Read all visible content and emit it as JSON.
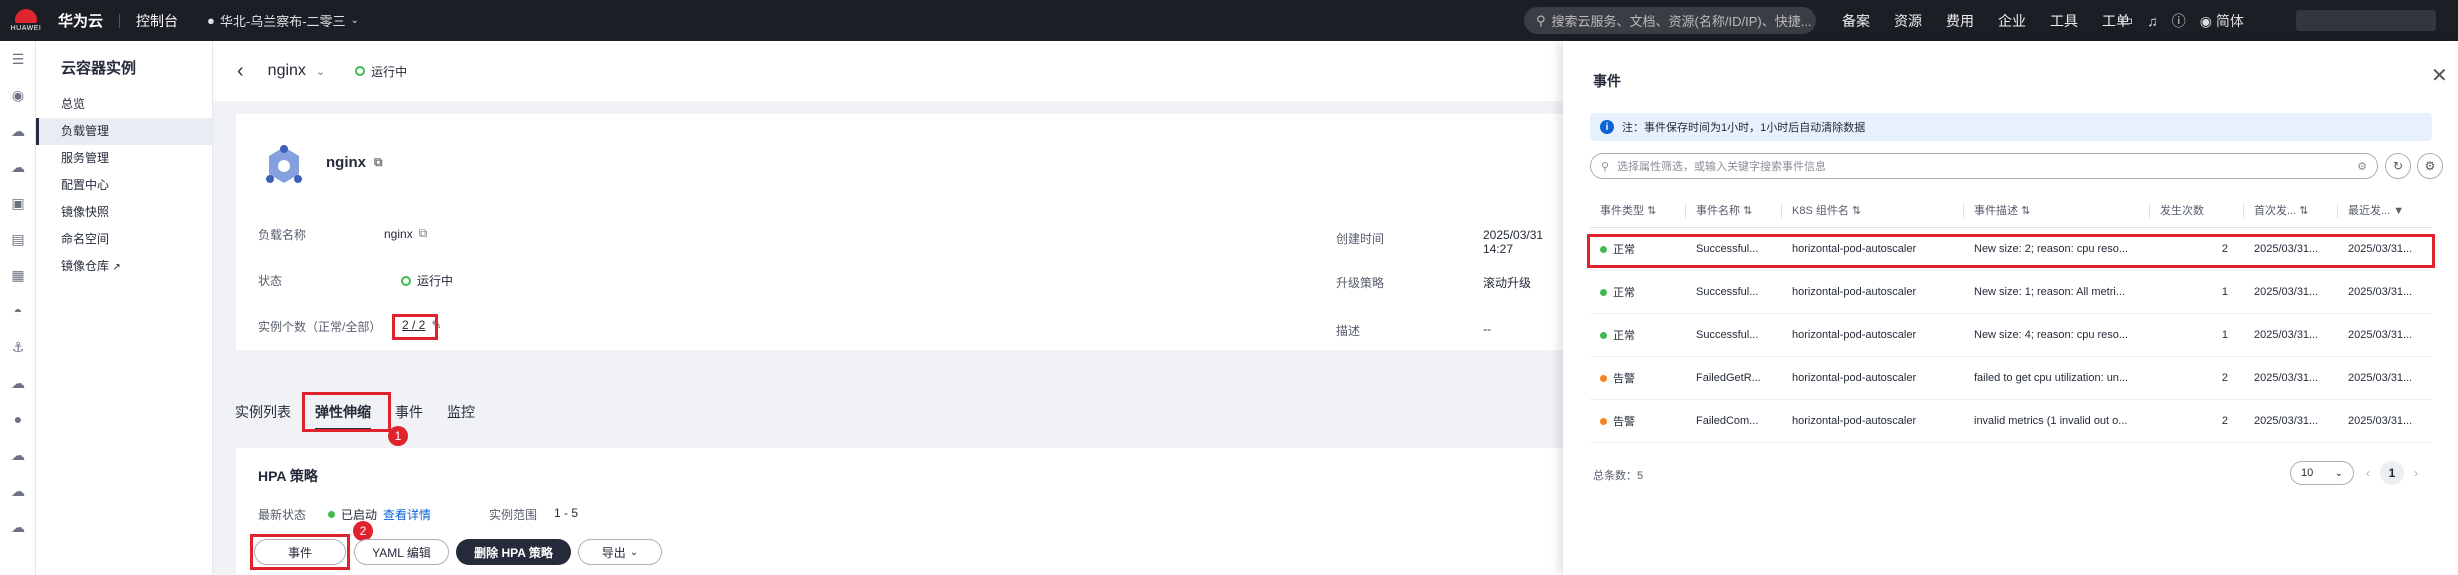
{
  "topbar": {
    "logo_text": "HUAWEI",
    "brand": "华为云",
    "console": "控制台",
    "region": "华北-乌兰察布-二零三",
    "search_placeholder": "搜索云服务、文档、资源(名称/ID/IP)、快捷...",
    "nav": [
      "备案",
      "资源",
      "费用",
      "企业",
      "工具",
      "工单"
    ],
    "lang": "简体"
  },
  "sidemenu": {
    "title": "云容器实例",
    "items": [
      "总览",
      "负载管理",
      "服务管理",
      "配置中心",
      "镜像快照",
      "命名空间",
      "镜像仓库"
    ],
    "active_index": 1
  },
  "header": {
    "workload_name": "nginx",
    "status": "运行中"
  },
  "detail": {
    "title": "nginx",
    "fields": {
      "name_label": "负载名称",
      "name_value": "nginx",
      "status_label": "状态",
      "status_value": "运行中",
      "instances_label": "实例个数（正常/全部）",
      "instances_value": "2 / 2",
      "created_label": "创建时间",
      "created_value": "2025/03/31 14:27",
      "strategy_label": "升级策略",
      "strategy_value": "滚动升级",
      "desc_label": "描述",
      "desc_value": "--"
    }
  },
  "tabs": {
    "items": [
      "实例列表",
      "弹性伸缩",
      "事件",
      "监控"
    ],
    "active_index": 1
  },
  "callouts": {
    "tab_num": "1",
    "btn_num": "2"
  },
  "hpa": {
    "title": "HPA 策略",
    "latest_status_label": "最新状态",
    "latest_status_value": "已启动",
    "view_detail": "查看详情",
    "range_label": "实例范围",
    "range_value": "1 - 5",
    "buttons": {
      "events": "事件",
      "yaml": "YAML 编辑",
      "delete": "删除 HPA 策略",
      "export": "导出"
    }
  },
  "drawer": {
    "title": "事件",
    "note": "注：事件保存时间为1小时，1小时后自动清除数据",
    "search_placeholder": "选择属性筛选，或输入关键字搜索事件信息",
    "columns": [
      "事件类型",
      "事件名称",
      "K8S 组件名",
      "事件描述",
      "发生次数",
      "首次发...",
      "最近发..."
    ],
    "rows": [
      {
        "type": "正常",
        "type_color": "#3fb950",
        "name": "Successful...",
        "component": "horizontal-pod-autoscaler",
        "desc": "New size: 2; reason: cpu reso...",
        "count": "2",
        "first": "2025/03/31...",
        "last": "2025/03/31..."
      },
      {
        "type": "正常",
        "type_color": "#3fb950",
        "name": "Successful...",
        "component": "horizontal-pod-autoscaler",
        "desc": "New size: 1; reason: All metri...",
        "count": "1",
        "first": "2025/03/31...",
        "last": "2025/03/31..."
      },
      {
        "type": "正常",
        "type_color": "#3fb950",
        "name": "Successful...",
        "component": "horizontal-pod-autoscaler",
        "desc": "New size: 4; reason: cpu reso...",
        "count": "1",
        "first": "2025/03/31...",
        "last": "2025/03/31..."
      },
      {
        "type": "告警",
        "type_color": "#f58220",
        "name": "FailedGetR...",
        "component": "horizontal-pod-autoscaler",
        "desc": "failed to get cpu utilization: un...",
        "count": "2",
        "first": "2025/03/31...",
        "last": "2025/03/31..."
      },
      {
        "type": "告警",
        "type_color": "#f58220",
        "name": "FailedCom...",
        "component": "horizontal-pod-autoscaler",
        "desc": "invalid metrics (1 invalid out o...",
        "count": "2",
        "first": "2025/03/31...",
        "last": "2025/03/31..."
      }
    ],
    "total_label": "总条数：5",
    "page_size": "10",
    "current_page": "1"
  }
}
